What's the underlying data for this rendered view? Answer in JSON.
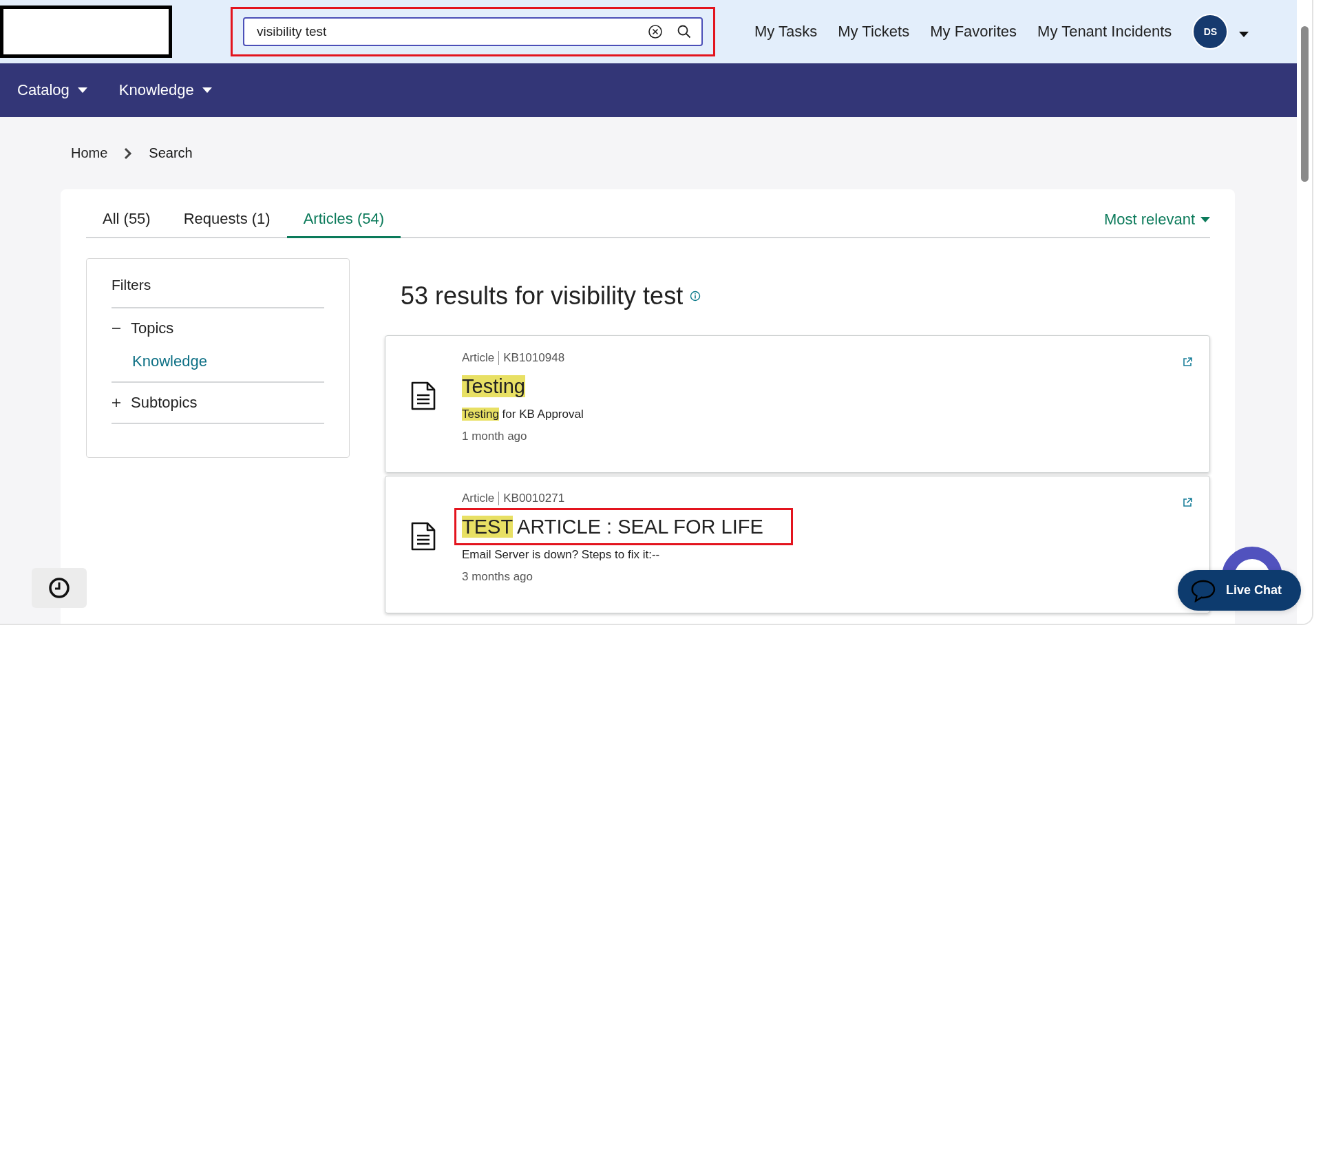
{
  "search": {
    "value": "visibility test"
  },
  "top_nav": [
    "My Tasks",
    "My Tickets",
    "My Favorites",
    "My Tenant Incidents"
  ],
  "user": {
    "initials": "DS"
  },
  "menu": [
    {
      "label": "Catalog"
    },
    {
      "label": "Knowledge"
    }
  ],
  "breadcrumb": [
    "Home",
    "Search"
  ],
  "tabs": [
    {
      "label": "All (55)",
      "selected": false
    },
    {
      "label": "Requests (1)",
      "selected": false
    },
    {
      "label": "Articles (54)",
      "selected": true
    }
  ],
  "sort": "Most relevant",
  "filters": {
    "title": "Filters",
    "groups": [
      {
        "label": "Topics",
        "expanded": true,
        "children": [
          {
            "label": "Knowledge"
          }
        ]
      },
      {
        "label": "Subtopics",
        "expanded": false
      }
    ]
  },
  "results_heading": "53 results for visibility test",
  "results": [
    {
      "type": "Article",
      "number": "KB1010948",
      "annotated": false,
      "title": [
        {
          "text": "Testing",
          "highlighted": true
        }
      ],
      "summary": [
        {
          "text": "Testing",
          "highlighted": true
        },
        {
          "text": " for KB Approval",
          "highlighted": false
        }
      ],
      "age": "1 month ago"
    },
    {
      "type": "Article",
      "number": "KB0010271",
      "annotated": true,
      "title": [
        {
          "text": "TEST",
          "highlighted": true
        },
        {
          "text": " ARTICLE : SEAL FOR LIFE",
          "highlighted": false
        }
      ],
      "summary": [
        {
          "text": "Email Server is down? Steps to fix it:--",
          "highlighted": false
        }
      ],
      "age": "3 months ago"
    }
  ],
  "live_chat": {
    "label": "Live Chat"
  }
}
